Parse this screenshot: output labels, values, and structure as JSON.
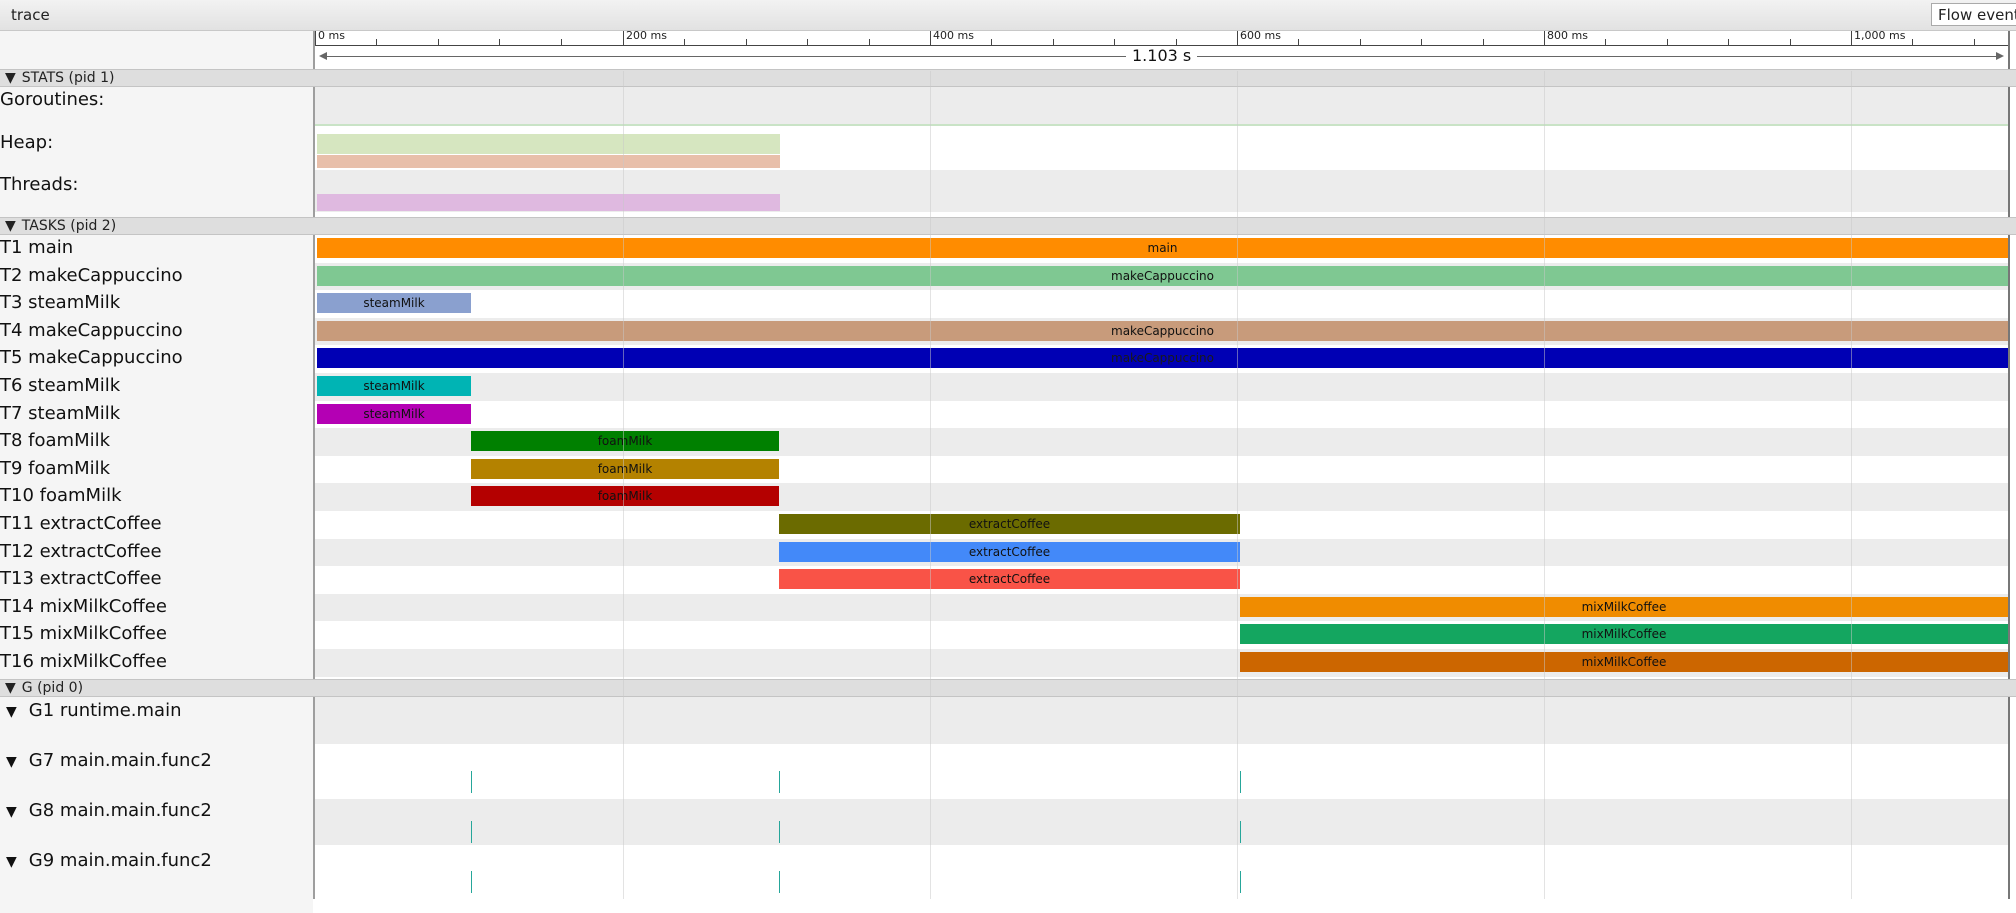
{
  "app": {
    "title": "trace",
    "flow_button": "Flow events"
  },
  "ruler": {
    "labels": [
      "0 ms",
      "200 ms",
      "400 ms",
      "600 ms",
      "800 ms",
      "1,000 ms"
    ],
    "duration": "1.103 s"
  },
  "sections": {
    "stats": "STATS (pid 1)",
    "tasks": "TASKS (pid 2)",
    "g": "G (pid 0)"
  },
  "stats": {
    "goroutines": "Goroutines:",
    "heap": "Heap:",
    "threads": "Threads:"
  },
  "colors": {
    "heap_a": "#d6e6c0",
    "heap_b": "#e8bfaa",
    "threads": "#dfb9e0"
  },
  "tasks": [
    {
      "label": "T1 main",
      "bar": "main",
      "color": "#ff8c00"
    },
    {
      "label": "T2 makeCappuccino",
      "bar": "makeCappuccino",
      "color": "#7fc892"
    },
    {
      "label": "T3 steamMilk",
      "bar": "steamMilk",
      "color": "#8aa0cf"
    },
    {
      "label": "T4 makeCappuccino",
      "bar": "makeCappuccino",
      "color": "#c89b7b"
    },
    {
      "label": "T5 makeCappuccino",
      "bar": "makeCappuccino",
      "color": "#0000b4"
    },
    {
      "label": "T6 steamMilk",
      "bar": "steamMilk",
      "color": "#00b4b4"
    },
    {
      "label": "T7 steamMilk",
      "bar": "steamMilk",
      "color": "#b400b4"
    },
    {
      "label": "T8 foamMilk",
      "bar": "foamMilk",
      "color": "#008000"
    },
    {
      "label": "T9 foamMilk",
      "bar": "foamMilk",
      "color": "#b48200"
    },
    {
      "label": "T10 foamMilk",
      "bar": "foamMilk",
      "color": "#b40000"
    },
    {
      "label": "T11 extractCoffee",
      "bar": "extractCoffee",
      "color": "#6b6b00"
    },
    {
      "label": "T12 extractCoffee",
      "bar": "extractCoffee",
      "color": "#4389f9"
    },
    {
      "label": "T13 extractCoffee",
      "bar": "extractCoffee",
      "color": "#f95347"
    },
    {
      "label": "T14 mixMilkCoffee",
      "bar": "mixMilkCoffee",
      "color": "#f08c00"
    },
    {
      "label": "T15 mixMilkCoffee",
      "bar": "mixMilkCoffee",
      "color": "#14a660"
    },
    {
      "label": "T16 mixMilkCoffee",
      "bar": "mixMilkCoffee",
      "color": "#cc6600"
    }
  ],
  "goroutines": [
    {
      "label": "G1 runtime.main"
    },
    {
      "label": "G7 main.main.func2"
    },
    {
      "label": "G8 main.main.func2"
    },
    {
      "label": "G9 main.main.func2"
    }
  ]
}
